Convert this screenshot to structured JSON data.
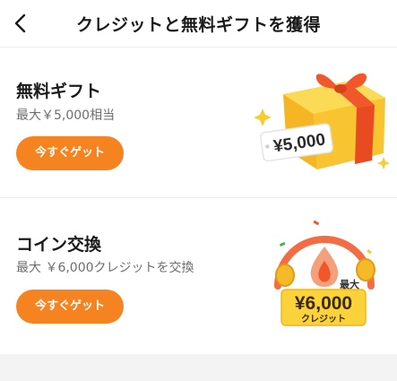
{
  "header": {
    "title": "クレジットと無料ギフトを獲得"
  },
  "gift": {
    "title": "無料ギフト",
    "subtitle": "最大￥5,000相当",
    "button_label": "今すぐゲット",
    "tag_text": "¥5,000"
  },
  "coin": {
    "title": "コイン交換",
    "subtitle": "最大 ￥6,000クレジットを交換",
    "button_label": "今すぐゲット",
    "badge_max": "最大",
    "badge_amount": "¥6,000",
    "badge_unit": "クレジット"
  },
  "colors": {
    "accent": "#f5831f",
    "gift_yellow": "#f7c32e",
    "ribbon": "#f2562b"
  }
}
